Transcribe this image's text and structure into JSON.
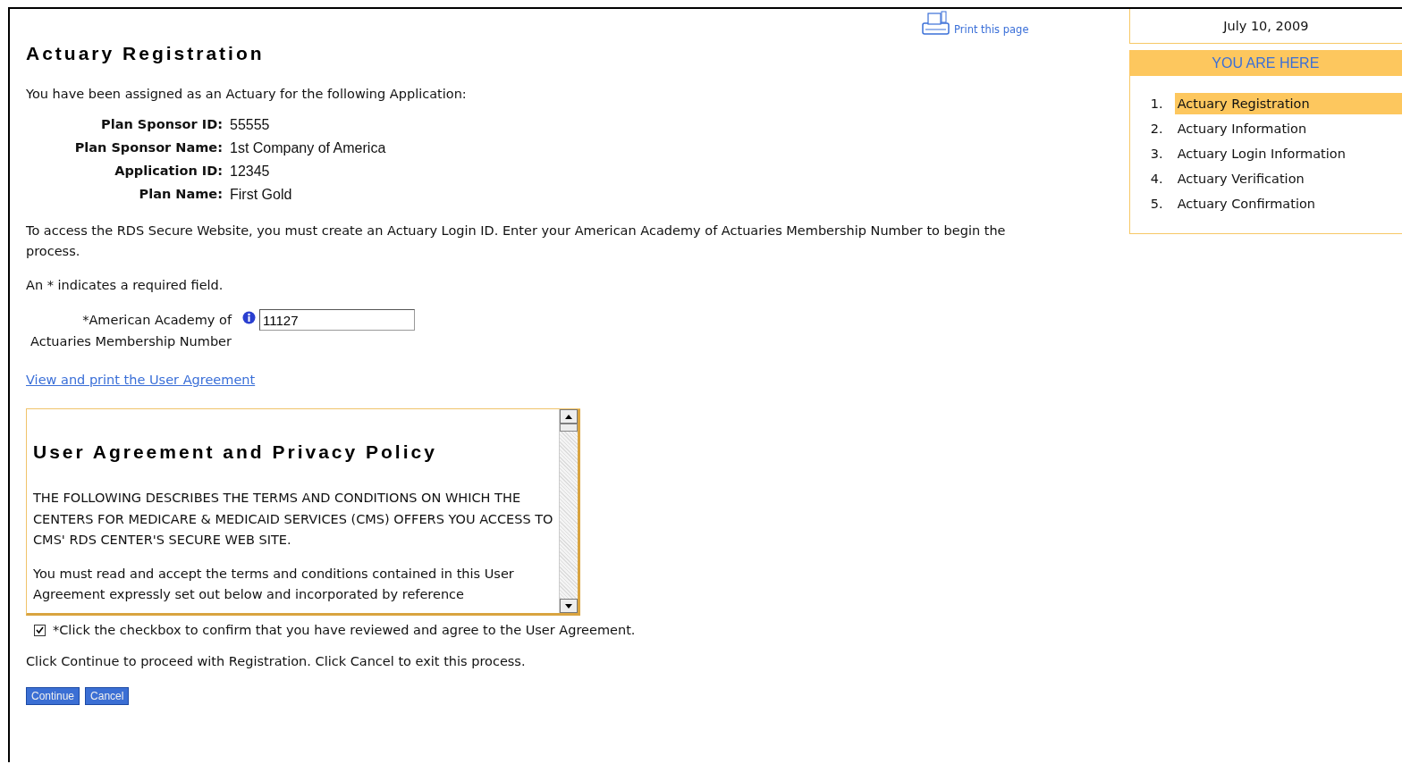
{
  "print_link": "Print this page",
  "title": "Actuary Registration",
  "intro": "You have been assigned as an Actuary for the following Application:",
  "details": [
    {
      "label": "Plan Sponsor ID:",
      "value": "55555"
    },
    {
      "label": "Plan Sponsor Name:",
      "value": "1st Company of America"
    },
    {
      "label": "Application ID:",
      "value": "12345"
    },
    {
      "label": "Plan Name:",
      "value": "First Gold"
    }
  ],
  "instructions": "To access the RDS Secure Website, you must create an Actuary Login ID. Enter your American Academy of Actuaries Membership Number to begin the process.",
  "required_note": "An * indicates a required field.",
  "membership_field": {
    "label": "*American Academy of Actuaries Membership Number",
    "value": "11127"
  },
  "agreement_link": "View and print the User Agreement",
  "agreement": {
    "title": "User Agreement and Privacy Policy",
    "paragraphs": [
      "THE FOLLOWING DESCRIBES THE TERMS AND CONDITIONS ON WHICH THE CENTERS FOR MEDICARE & MEDICAID SERVICES (CMS) OFFERS YOU ACCESS TO CMS' RDS CENTER'S SECURE WEB SITE.",
      "You must read and accept the terms and conditions contained in this User Agreement expressly set out below and incorporated by reference"
    ]
  },
  "agree_checkbox": {
    "label": "*Click the checkbox to confirm that you have reviewed and agree to the User Agreement.",
    "checked": true
  },
  "continue_note": "Click Continue to proceed with Registration. Click Cancel to exit this process.",
  "buttons": [
    "Continue",
    "Cancel"
  ],
  "sidebar": {
    "date": "July 10, 2009",
    "heading": "YOU ARE HERE",
    "steps": [
      {
        "number": "1.",
        "label": "Actuary Registration",
        "selected": true
      },
      {
        "number": "2.",
        "label": "Actuary Information",
        "selected": false
      },
      {
        "number": "3.",
        "label": "Actuary Login Information",
        "selected": false
      },
      {
        "number": "4.",
        "label": "Actuary Verification",
        "selected": false
      },
      {
        "number": "5.",
        "label": "Actuary Confirmation",
        "selected": false
      }
    ]
  }
}
